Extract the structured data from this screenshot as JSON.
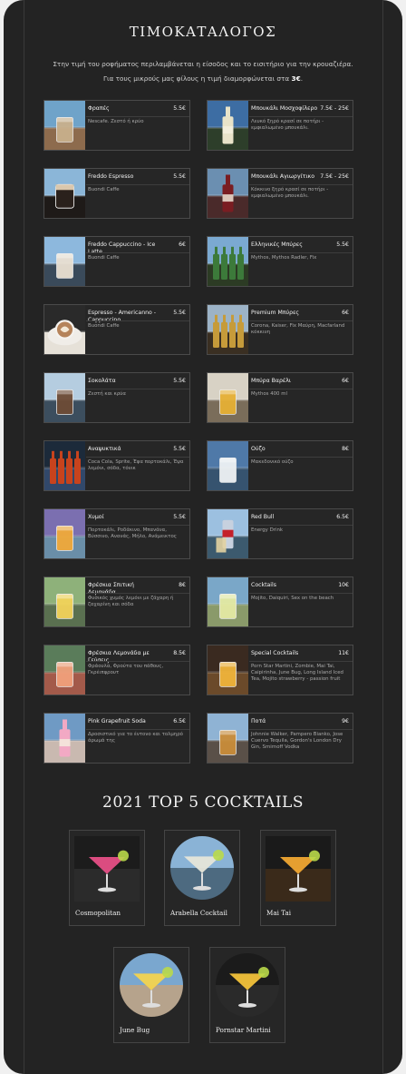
{
  "menu": {
    "title": "ΤΙΜΟΚΑΤΑΛΟΓΟΣ",
    "note_line1": "Στην τιμή του ροφήματος περιλαμβάνεται η είσοδος και το εισιτήριο για την κρουαζιέρα.",
    "note_line2_prefix": "Για τους μικρούς μας φίλους η τιμή διαμορφώνεται στα ",
    "note_line2_price": "3€",
    "note_line2_suffix": ".",
    "items": [
      {
        "name": "Φραπές",
        "price": "5.5€",
        "desc": "Nescafe. Ζεστό ή κρύο",
        "icon": "frappe-icon"
      },
      {
        "name": "Μπουκάλι Μοσχοφίλερο",
        "price": "7.5€ - 25€",
        "desc": "Λευκό ξηρό κρασί σε ποτήρι - εμφιαλωμένο μπουκάλι.",
        "icon": "white-wine-icon"
      },
      {
        "name": "Freddo Espresso",
        "price": "5.5€",
        "desc": "Buondi Caffe",
        "icon": "freddo-espresso-icon"
      },
      {
        "name": "Μπουκάλι Αγιωργίτικο",
        "price": "7.5€ - 25€",
        "desc": "Κόκκινο ξηρό κρασί σε ποτήρι - εμφιαλωμένο μπουκάλι.",
        "icon": "red-wine-icon"
      },
      {
        "name": "Freddo Cappuccino - Ice Latte",
        "price": "6€",
        "desc": "Buondi Caffe",
        "icon": "freddo-cappuccino-icon"
      },
      {
        "name": "Ελληνικές Μπύρες",
        "price": "5.5€",
        "desc": "Mythos, Mythos Radler, Fix",
        "icon": "greek-beers-icon"
      },
      {
        "name": "Espresso - Americanno - Cappuccino",
        "price": "5.5€",
        "desc": "Buondi Caffe",
        "icon": "cappuccino-icon"
      },
      {
        "name": "Premium Μπύρες",
        "price": "6€",
        "desc": "Corona, Kaiser, Fix Μαύρη, Macfarland κόκκινη",
        "icon": "premium-beers-icon"
      },
      {
        "name": "Σοκολάτα",
        "price": "5.5€",
        "desc": "Ζεστή και κρύα",
        "icon": "chocolate-icon"
      },
      {
        "name": "Μπύρα Βαρέλι",
        "price": "6€",
        "desc": "Mythos 400 ml",
        "icon": "draft-beer-icon"
      },
      {
        "name": "Αναψυκτικά",
        "price": "5.5€",
        "desc": "Coca Cola, Sprite, Έψα πορτοκάλι, Έψα λεμόνι, σόδα, τόνικ",
        "icon": "soft-drinks-icon"
      },
      {
        "name": "Ούζο",
        "price": "8€",
        "desc": "Μακεδονικό ούζο",
        "icon": "ouzo-icon"
      },
      {
        "name": "Χυμοί",
        "price": "5.5€",
        "desc": "Πορτοκάλι, Ροδάκινο, Μπανάνα, Βύσσινο, Ανανάς, Μήλο, Ανάμεικτος",
        "icon": "juices-icon"
      },
      {
        "name": "Red Bull",
        "price": "6.5€",
        "desc": "Energy Drink",
        "icon": "red-bull-icon"
      },
      {
        "name": "Φρέσκια Σπιτική Λεμονάδα",
        "price": "8€",
        "desc": "Φυσικός χυμός λεμόνι με ζάχαρη ή ζαχαρίνη και σόδα",
        "icon": "lemonade-icon"
      },
      {
        "name": "Cocktails",
        "price": "10€",
        "desc": "Mojito, Daiquiri, Sex on the beach",
        "icon": "cocktails-icon"
      },
      {
        "name": "Φρέσκια Λεμονάδα με Γεύσεις",
        "price": "8.5€",
        "desc": "Φράουλα, Φρούτα του πάθους, Γκρέιπφρουτ",
        "icon": "flavored-lemonade-icon"
      },
      {
        "name": "Special Cocktails",
        "price": "11€",
        "desc": "Porn Star Martini, Zombie, Mai Tai, Caipirinha, June Bug, Long Island Iced Tea, Mojito strawberry - passion fruit",
        "icon": "special-cocktails-icon"
      },
      {
        "name": "Pink Grapefruit Soda",
        "price": "6.5€",
        "desc": "Δροσιστικό για το έντονο και τολμηρό άρωμά της",
        "icon": "grapefruit-soda-icon"
      },
      {
        "name": "Ποτά",
        "price": "9€",
        "desc": "Johnnie Walker, Pampero Bianko, Jose Cuervo Tequila, Gordon's London Dry Gin, Smirnoff Vodka",
        "icon": "spirits-icon"
      }
    ]
  },
  "top5": {
    "title": "2021 TOP 5 COCKTAILS",
    "items": [
      {
        "name": "Cosmopolitan",
        "icon": "cosmopolitan-icon"
      },
      {
        "name": "Arabella Cocktail",
        "icon": "arabella-cocktail-icon"
      },
      {
        "name": "Mai Tai",
        "icon": "mai-tai-icon"
      },
      {
        "name": "June Bug",
        "icon": "june-bug-icon"
      },
      {
        "name": "Pornstar Martini",
        "icon": "pornstar-martini-icon"
      }
    ]
  },
  "colors": {
    "background": "#232323",
    "card": "#262626",
    "border": "#4a4a4a",
    "text": "#f2f2f2",
    "muted": "#a9a9a9"
  }
}
